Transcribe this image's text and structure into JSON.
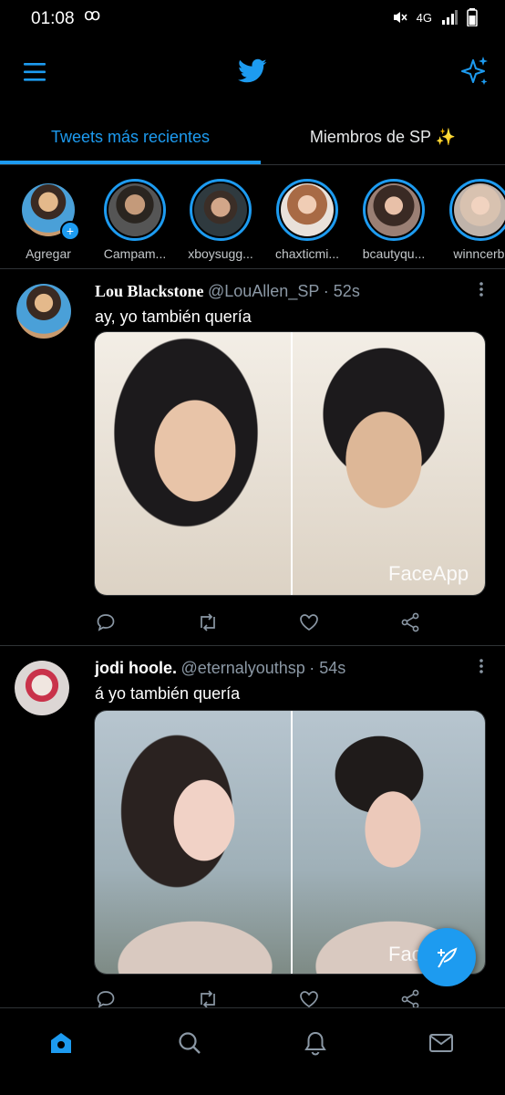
{
  "status_bar": {
    "time": "01:08",
    "voicemail_icon": "voicemail-icon",
    "network": "4G"
  },
  "app_bar": {
    "menu_icon": "hamburger-menu-icon",
    "logo_icon": "twitter-bird-icon",
    "sparkle_icon": "sparkle-icon"
  },
  "tabs": [
    {
      "label": "Tweets más recientes",
      "active": true
    },
    {
      "label": "Miembros de SP ✨",
      "active": false
    }
  ],
  "fleets": [
    {
      "label": "Agregar",
      "ring": false,
      "add": true
    },
    {
      "label": "Campam...",
      "ring": true
    },
    {
      "label": "xboysugg...",
      "ring": true
    },
    {
      "label": "chaxticmi...",
      "ring": true
    },
    {
      "label": "bcautyqu...",
      "ring": true
    },
    {
      "label": "winncerbl",
      "ring": true
    }
  ],
  "tweets": [
    {
      "name": "Lou Blackstone",
      "handle": "@LouAllen_SP",
      "time": "· 52s",
      "text": "ay, yo también quería",
      "watermark": "FaceApp"
    },
    {
      "name": "jodi hoole.",
      "handle": "@eternalyouthsp",
      "time": "· 54s",
      "text": "á yo también quería",
      "watermark": "Face"
    }
  ],
  "actions": [
    "reply-icon",
    "retweet-icon",
    "like-icon",
    "share-icon"
  ],
  "bottom_nav": [
    "home-icon",
    "search-icon",
    "notifications-icon",
    "messages-icon"
  ],
  "colors": {
    "accent": "#1d9bf0",
    "background": "#000000",
    "divider": "#2f3336",
    "secondary_text": "#8b98a5"
  }
}
